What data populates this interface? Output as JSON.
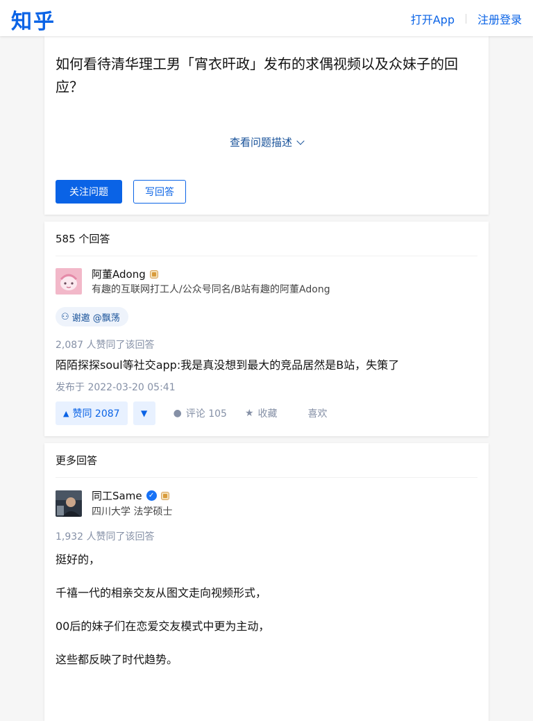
{
  "header": {
    "logo": "知乎",
    "open_app": "打开App",
    "login": "注册登录"
  },
  "question": {
    "title": "如何看待清华理工男「宵衣旰政」发布的求偶视频以及众妹子的回应？",
    "view_desc": "查看问题描述",
    "follow": "关注问题",
    "write": "写回答"
  },
  "answers": {
    "count_label": "585 个回答",
    "first": {
      "author": "阿董Adong",
      "bio": "有趣的互联网打工人/公众号同名/B站有趣的阿董Adong",
      "invite": "谢邀 @飘荡",
      "vote_line": "2,087 人赞同了该回答",
      "text": "陌陌探探soul等社交app:我是真没想到最大的竞品居然是B站，失策了",
      "date": "发布于 2022-03-20 05:41",
      "upvote": "赞同 2087",
      "comment": "评论 105",
      "collect": "收藏",
      "like": "喜欢"
    }
  },
  "more": {
    "title": "更多回答",
    "author": "同工Same",
    "bio": "四川大学 法学硕士",
    "vote_line": "1,932 人赞同了该回答",
    "paragraphs": [
      "挺好的，",
      "千禧一代的相亲交友从图文走向视频形式，",
      "00后的妹子们在恋爱交友模式中更为主动，",
      "这些都反映了时代趋势。"
    ]
  },
  "colors": {
    "brand": "#0a63e6",
    "link": "#175199",
    "muted": "#8590a6"
  }
}
